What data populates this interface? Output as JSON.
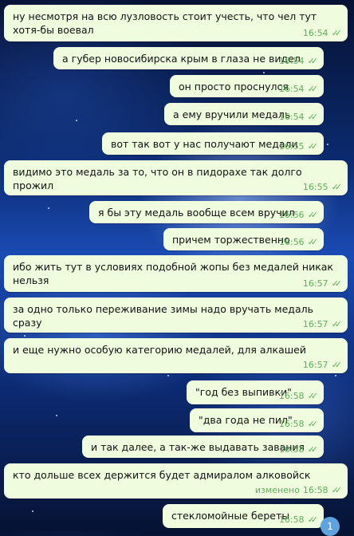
{
  "messages": [
    {
      "text": "ну несмотря на всю лузловость стоит учесть, что чел тут хотя-бы воевал",
      "time": "16:54"
    },
    {
      "text": "а губер новосибирска крым в глаза не видел",
      "time": "16:54"
    },
    {
      "text": "он просто проснулся",
      "time": "16:54"
    },
    {
      "text": "а ему вручили медаль",
      "time": "16:54"
    },
    {
      "text": "вот так вот у нас получают медали",
      "time": "16:55"
    },
    {
      "text": "видимо это медаль за то, что он в пидорахе так долго прожил",
      "time": "16:55"
    },
    {
      "text": "я бы эту медаль вообще всем вручил",
      "time": "16:56"
    },
    {
      "text": "причем торжественно",
      "time": "16:56"
    },
    {
      "text": "ибо жить тут в условиях подобной жопы без медалей никак нельзя",
      "time": "16:57"
    },
    {
      "text": "за одно только переживание зимы надо вручать медаль сразу",
      "time": "16:57"
    },
    {
      "text": "и еще нужно особую категорию медалей, для алкашей",
      "time": "16:57"
    },
    {
      "text": "\"год без выпивки\"",
      "time": "16:58"
    },
    {
      "text": "\"два года не пил\"",
      "time": "16:58"
    },
    {
      "text": "и так далее, а так-же выдавать завания",
      "time": "16:58"
    },
    {
      "text": "кто дольше всех держится будет адмиралом алковойск",
      "time": "16:58",
      "edited": "изменено"
    },
    {
      "text": "стекломойные береты",
      "time": "16:58"
    }
  ],
  "unread_count": "1",
  "colors": {
    "bubble": "#effdde",
    "time": "#5eae5a",
    "badge": "#5fa3de"
  }
}
